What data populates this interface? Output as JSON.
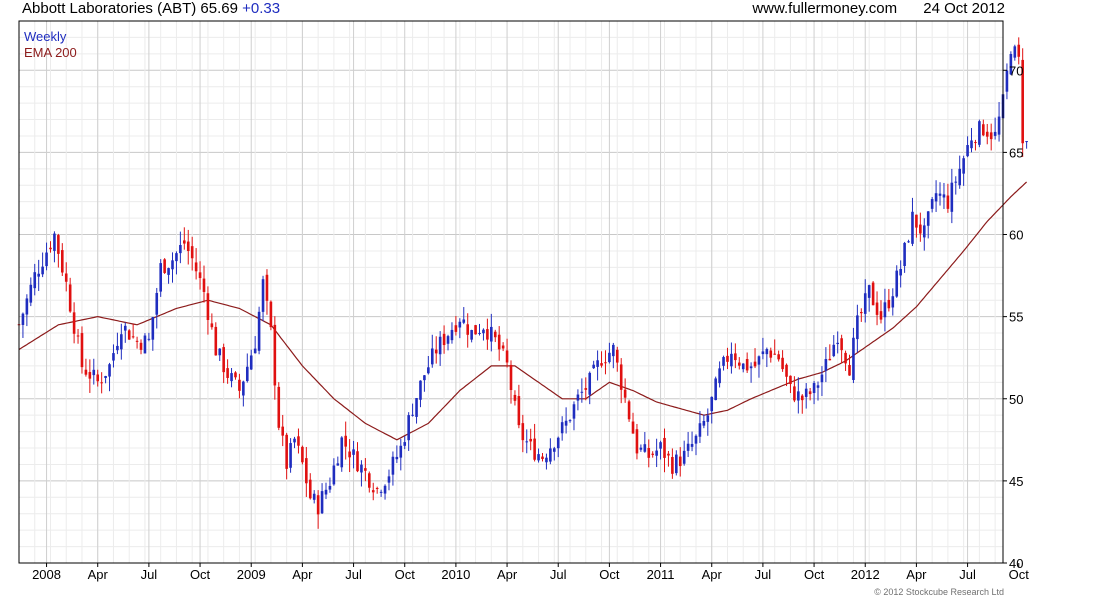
{
  "header": {
    "title": "Abbott Laboratories (ABT) 65.69",
    "change": "+0.33",
    "site": "www.fullermoney.com",
    "date": "24 Oct 2012"
  },
  "copyright": "© 2012 Stockcube Research Ltd",
  "colors": {
    "up": "#1f2dbf",
    "down": "#e01010",
    "ema": "#8c1b1b",
    "grid": "#dddddd",
    "axis": "#000000"
  },
  "chart_data": {
    "type": "candlestick",
    "legend": [
      "Weekly",
      "EMA 200"
    ],
    "legend_position": "top-left",
    "grid": true,
    "y_axis": {
      "position": "right",
      "range": [
        40,
        73
      ],
      "ticks": [
        40,
        45,
        50,
        55,
        60,
        65,
        70
      ]
    },
    "x_range": [
      0,
      250
    ],
    "x_ticks": [
      {
        "label": "2008",
        "x": 7
      },
      {
        "label": "Apr",
        "x": 20
      },
      {
        "label": "Jul",
        "x": 33
      },
      {
        "label": "Oct",
        "x": 46
      },
      {
        "label": "2009",
        "x": 59
      },
      {
        "label": "Apr",
        "x": 72
      },
      {
        "label": "Jul",
        "x": 85
      },
      {
        "label": "Oct",
        "x": 98
      },
      {
        "label": "2010",
        "x": 111
      },
      {
        "label": "Apr",
        "x": 124
      },
      {
        "label": "Jul",
        "x": 137
      },
      {
        "label": "Oct",
        "x": 150
      },
      {
        "label": "2011",
        "x": 163
      },
      {
        "label": "Apr",
        "x": 176
      },
      {
        "label": "Jul",
        "x": 189
      },
      {
        "label": "Oct",
        "x": 202
      },
      {
        "label": "2012",
        "x": 215
      },
      {
        "label": "Apr",
        "x": 228
      },
      {
        "label": "Jul",
        "x": 241
      },
      {
        "label": "Oct",
        "x": 254
      }
    ],
    "close_anchors": [
      [
        0,
        54.5
      ],
      [
        4,
        57.5
      ],
      [
        9,
        60.0
      ],
      [
        12,
        57.0
      ],
      [
        16,
        52.0
      ],
      [
        20,
        51.0
      ],
      [
        23,
        52.0
      ],
      [
        26,
        54.5
      ],
      [
        30,
        53.5
      ],
      [
        33,
        53.5
      ],
      [
        36,
        58.0
      ],
      [
        39,
        58.5
      ],
      [
        42,
        59.5
      ],
      [
        44,
        58.5
      ],
      [
        47,
        56.5
      ],
      [
        50,
        53.0
      ],
      [
        53,
        51.5
      ],
      [
        56,
        50.5
      ],
      [
        58,
        52.0
      ],
      [
        60,
        53.5
      ],
      [
        62,
        57.0
      ],
      [
        64,
        54.0
      ],
      [
        66,
        48.5
      ],
      [
        68,
        46.0
      ],
      [
        70,
        47.5
      ],
      [
        72,
        46.0
      ],
      [
        74,
        44.0
      ],
      [
        76,
        43.5
      ],
      [
        79,
        45.0
      ],
      [
        82,
        47.5
      ],
      [
        85,
        46.5
      ],
      [
        88,
        45.5
      ],
      [
        91,
        44.5
      ],
      [
        94,
        45.5
      ],
      [
        97,
        47.0
      ],
      [
        100,
        49.5
      ],
      [
        103,
        51.5
      ],
      [
        106,
        53.0
      ],
      [
        109,
        54.0
      ],
      [
        112,
        55.0
      ],
      [
        115,
        54.0
      ],
      [
        118,
        54.5
      ],
      [
        121,
        53.5
      ],
      [
        124,
        52.0
      ],
      [
        127,
        48.0
      ],
      [
        130,
        47.0
      ],
      [
        133,
        46.5
      ],
      [
        136,
        47.5
      ],
      [
        139,
        48.5
      ],
      [
        142,
        50.0
      ],
      [
        145,
        51.0
      ],
      [
        148,
        52.5
      ],
      [
        151,
        53.0
      ],
      [
        154,
        50.0
      ],
      [
        157,
        47.0
      ],
      [
        160,
        46.5
      ],
      [
        163,
        47.0
      ],
      [
        166,
        46.0
      ],
      [
        169,
        46.5
      ],
      [
        172,
        47.5
      ],
      [
        175,
        49.0
      ],
      [
        178,
        51.5
      ],
      [
        181,
        53.0
      ],
      [
        184,
        52.0
      ],
      [
        187,
        52.0
      ],
      [
        190,
        53.0
      ],
      [
        193,
        52.5
      ],
      [
        196,
        50.5
      ],
      [
        199,
        50.0
      ],
      [
        202,
        50.5
      ],
      [
        205,
        52.0
      ],
      [
        208,
        54.0
      ],
      [
        211,
        52.0
      ],
      [
        213,
        54.5
      ],
      [
        216,
        56.5
      ],
      [
        219,
        55.0
      ],
      [
        221,
        56.0
      ],
      [
        224,
        58.0
      ],
      [
        227,
        61.0
      ],
      [
        230,
        60.0
      ],
      [
        233,
        62.5
      ],
      [
        236,
        62.0
      ],
      [
        239,
        64.0
      ],
      [
        242,
        66.0
      ],
      [
        245,
        66.5
      ],
      [
        248,
        66.0
      ],
      [
        250,
        68.0
      ],
      [
        252,
        71.5
      ],
      [
        254,
        70.5
      ],
      [
        255,
        66.0
      ],
      [
        256,
        65.69
      ]
    ],
    "ema200_anchors": [
      [
        0,
        53.0
      ],
      [
        10,
        54.5
      ],
      [
        20,
        55.0
      ],
      [
        30,
        54.5
      ],
      [
        40,
        55.5
      ],
      [
        48,
        56.0
      ],
      [
        56,
        55.5
      ],
      [
        64,
        54.5
      ],
      [
        72,
        52.0
      ],
      [
        80,
        50.0
      ],
      [
        88,
        48.5
      ],
      [
        96,
        47.5
      ],
      [
        104,
        48.5
      ],
      [
        112,
        50.5
      ],
      [
        120,
        52.0
      ],
      [
        126,
        52.0
      ],
      [
        132,
        51.0
      ],
      [
        138,
        50.0
      ],
      [
        144,
        50.0
      ],
      [
        150,
        51.0
      ],
      [
        156,
        50.5
      ],
      [
        162,
        49.8
      ],
      [
        168,
        49.4
      ],
      [
        174,
        49.0
      ],
      [
        180,
        49.3
      ],
      [
        186,
        50.0
      ],
      [
        192,
        50.6
      ],
      [
        198,
        51.2
      ],
      [
        204,
        51.6
      ],
      [
        210,
        52.3
      ],
      [
        216,
        53.3
      ],
      [
        222,
        54.3
      ],
      [
        228,
        55.6
      ],
      [
        234,
        57.3
      ],
      [
        240,
        59.0
      ],
      [
        246,
        60.8
      ],
      [
        252,
        62.3
      ],
      [
        256,
        63.2
      ]
    ]
  }
}
